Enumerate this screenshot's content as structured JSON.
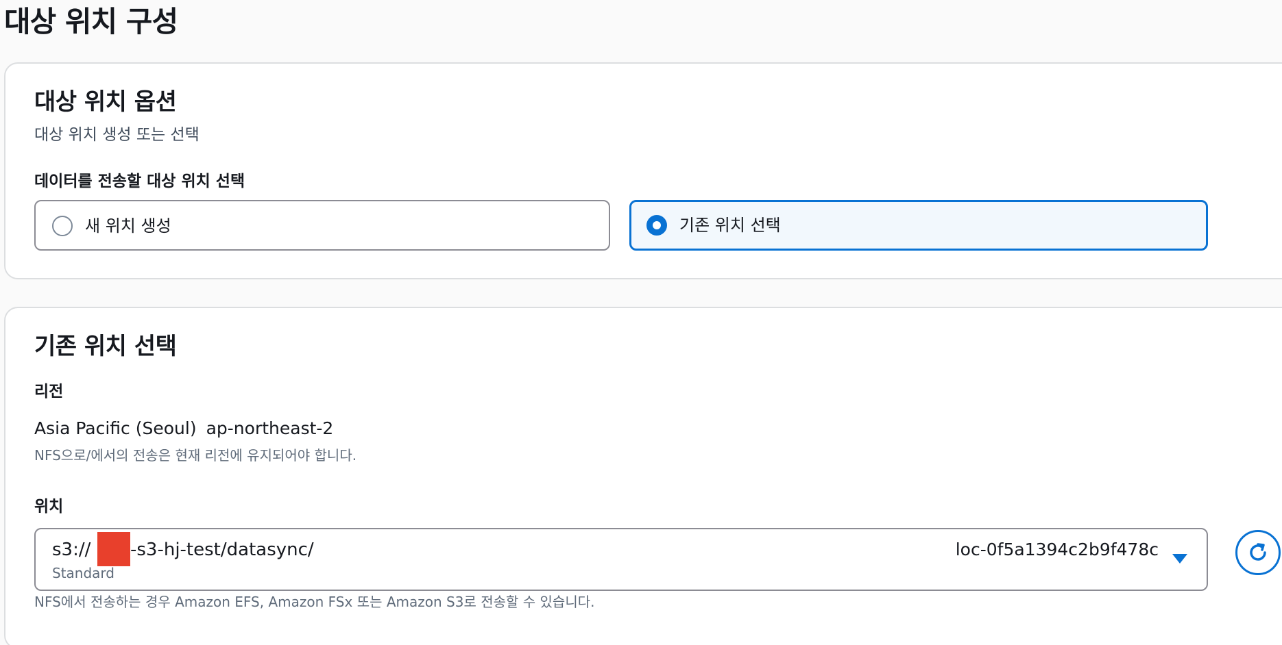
{
  "page_title": "대상 위치 구성",
  "options_panel": {
    "heading": "대상 위치 옵션",
    "description": "대상 위치 생성 또는 선택",
    "field_label": "데이터를 전송할 대상 위치 선택",
    "choices": [
      {
        "label": "새 위치 생성",
        "selected": false
      },
      {
        "label": "기존 위치 선택",
        "selected": true
      }
    ]
  },
  "existing_panel": {
    "heading": "기존 위치 선택",
    "region_label": "리전",
    "region_name": "Asia Pacific (Seoul)",
    "region_code": "ap-northeast-2",
    "region_hint": "NFS으로/에서의 전송은 현재 리전에 유지되어야 합니다.",
    "location_label": "위치",
    "location": {
      "path_prefix": "s3://",
      "path_suffix": "-s3-hj-test/datasync/",
      "storage_class": "Standard",
      "location_id": "loc-0f5a1394c2b9f478c"
    },
    "location_hint": "NFS에서 전송하는 경우 Amazon EFS, Amazon FSx 또는 Amazon S3로 전송할 수 있습니다."
  },
  "icons": {
    "refresh": "refresh-icon",
    "dropdown": "caret-down-icon"
  },
  "colors": {
    "accent": "#0972d3",
    "selected_bg": "#f2f8fd",
    "redaction": "#e8402c"
  }
}
